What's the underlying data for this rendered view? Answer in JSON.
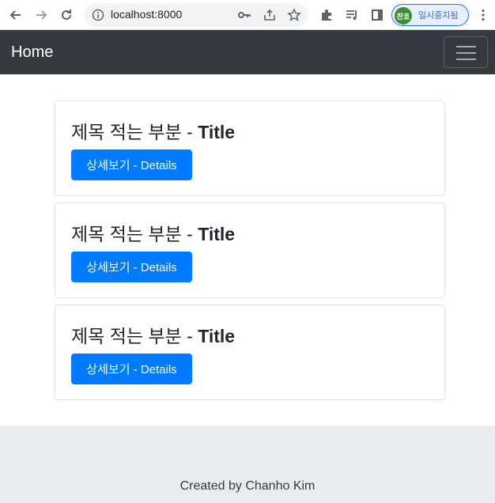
{
  "browser": {
    "url": "localhost:8000",
    "profile_avatar_text": "찬호",
    "profile_label": "일시중지됨",
    "icons": [
      "back-icon",
      "forward-icon",
      "reload-icon",
      "info-icon",
      "key-icon",
      "share-icon",
      "star-icon",
      "extensions-icon",
      "media-icon",
      "side-panel-icon",
      "menu-icon"
    ]
  },
  "navbar": {
    "brand": "Home",
    "background": "#343a40"
  },
  "cards": [
    {
      "title_prefix": "제목 적는 부분 - ",
      "title_bold": "Title",
      "button": "상세보기 - Details"
    },
    {
      "title_prefix": "제목 적는 부분 - ",
      "title_bold": "Title",
      "button": "상세보기 - Details"
    },
    {
      "title_prefix": "제목 적는 부분 - ",
      "title_bold": "Title",
      "button": "상세보기 - Details"
    }
  ],
  "footer": {
    "text": "Created by Chanho Kim"
  },
  "colors": {
    "primary": "#007bff",
    "footer_bg": "#e9ecef"
  }
}
